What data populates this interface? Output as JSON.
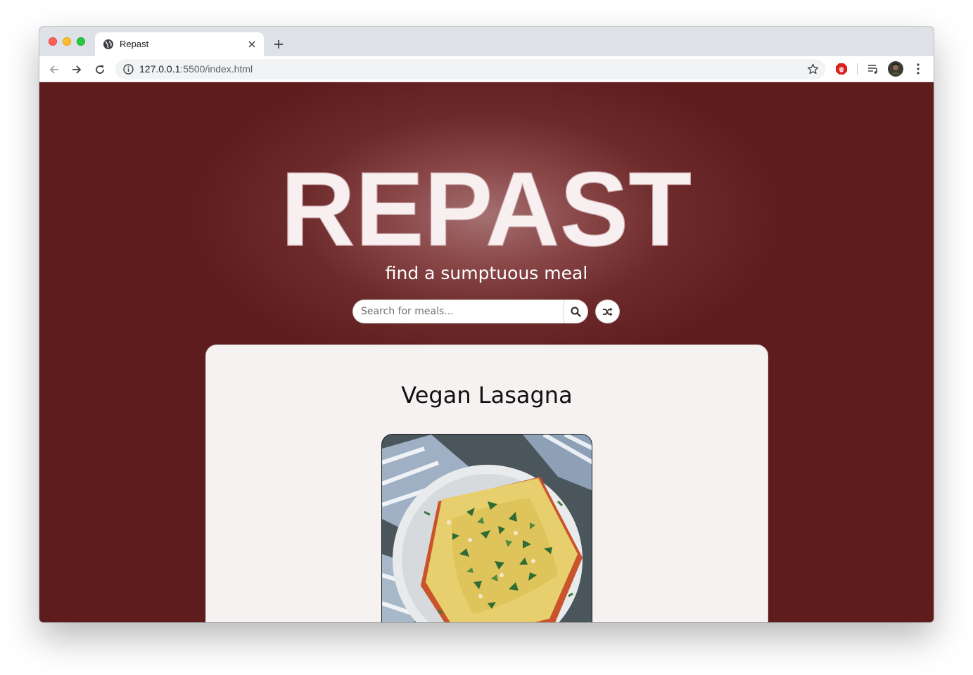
{
  "browser": {
    "tab_title": "Repast",
    "url_host": "127.0.0.1",
    "url_path": ":5500/index.html"
  },
  "hero": {
    "logo_text": "REPAST",
    "tagline": "find a sumptuous meal"
  },
  "search": {
    "placeholder": "Search for meals..."
  },
  "meal": {
    "title": "Vegan Lasagna",
    "image_desc": "lasagna-photo"
  },
  "colors": {
    "page_bg": "#5e1c1d",
    "card_bg": "#f5f2f1",
    "logo_fill": "#f8f0f0"
  }
}
